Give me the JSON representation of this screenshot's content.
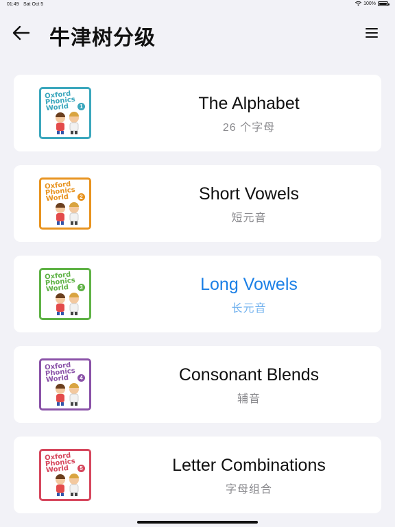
{
  "status_bar": {
    "time": "01:49",
    "date": "Sat Oct 5",
    "battery_text": "100%",
    "battery_level": 1.0
  },
  "header": {
    "title": "牛津树分级",
    "back_icon": "arrow-left-icon",
    "menu_icon": "hamburger-menu-icon"
  },
  "books": [
    {
      "title": "The Alphabet",
      "subtitle": "26 个字母",
      "cover_text": "Oxford Phonics World",
      "level": "1",
      "color": "#3ba7bd",
      "active": false
    },
    {
      "title": "Short Vowels",
      "subtitle": "短元音",
      "cover_text": "Oxford Phonics World",
      "level": "2",
      "color": "#e8931f",
      "active": false
    },
    {
      "title": "Long Vowels",
      "subtitle": "长元音",
      "cover_text": "Oxford Phonics World",
      "level": "3",
      "color": "#5fb246",
      "active": true
    },
    {
      "title": "Consonant Blends",
      "subtitle": "辅音",
      "cover_text": "Oxford Phonics World",
      "level": "4",
      "color": "#8a52a8",
      "active": false
    },
    {
      "title": "Letter Combinations",
      "subtitle": "字母组合",
      "cover_text": "Oxford Phonics World",
      "level": "5",
      "color": "#d6475d",
      "active": false
    }
  ],
  "colors": {
    "background": "#f2f2f7",
    "accent": "#1a7fe6",
    "accent_light": "#6fb0ee",
    "subtitle": "#8a8a8e"
  }
}
